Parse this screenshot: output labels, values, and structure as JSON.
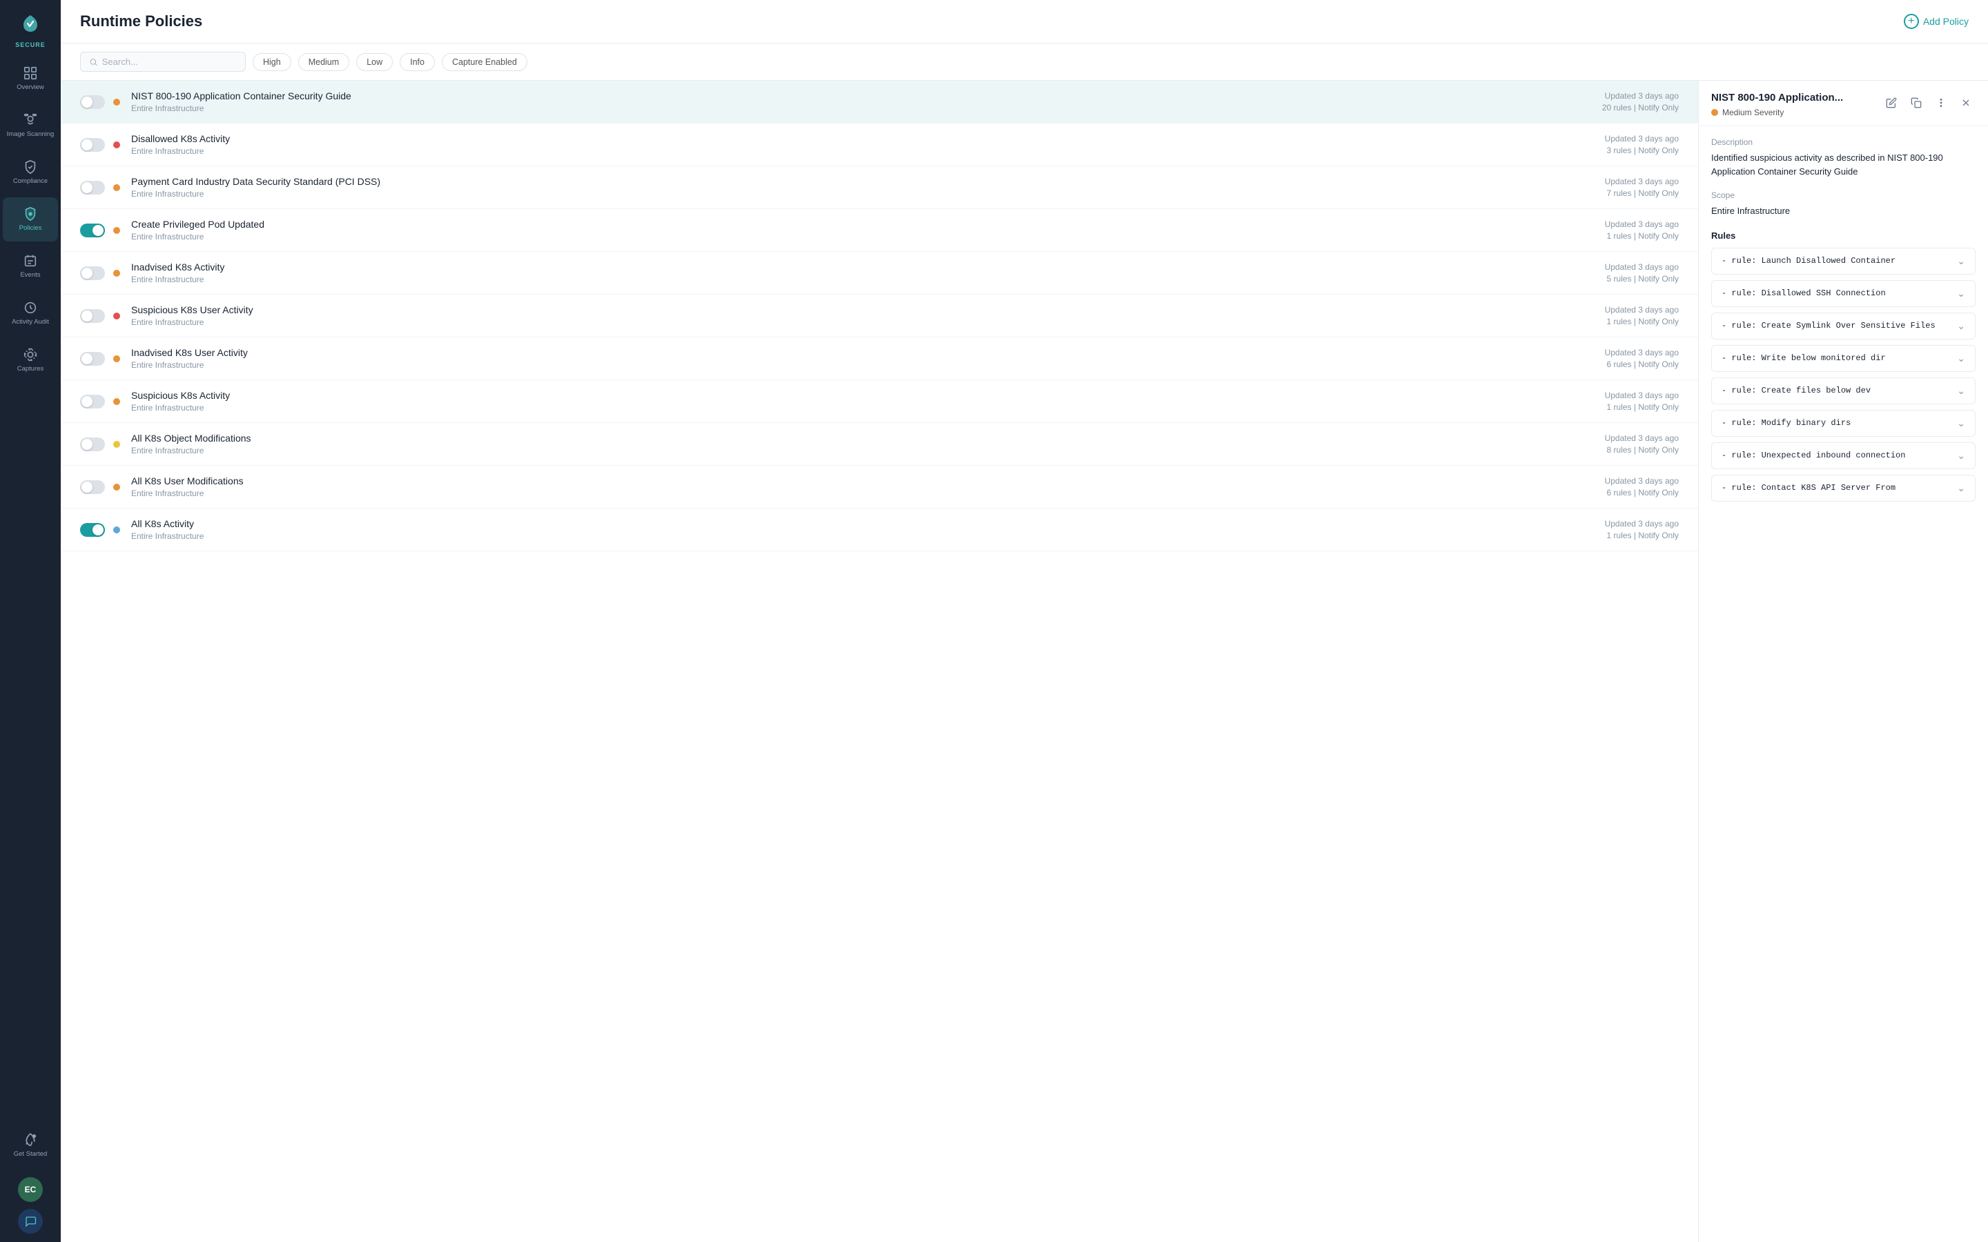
{
  "app": {
    "secure_label": "SECURE"
  },
  "sidebar": {
    "items": [
      {
        "id": "overview",
        "label": "Overview",
        "icon": "overview"
      },
      {
        "id": "image-scanning",
        "label": "Image Scanning",
        "icon": "scanning"
      },
      {
        "id": "compliance",
        "label": "Compliance",
        "icon": "compliance"
      },
      {
        "id": "policies",
        "label": "Policies",
        "icon": "policies",
        "active": true
      },
      {
        "id": "events",
        "label": "Events",
        "icon": "events"
      },
      {
        "id": "activity-audit",
        "label": "Activity Audit",
        "icon": "audit"
      },
      {
        "id": "captures",
        "label": "Captures",
        "icon": "captures"
      },
      {
        "id": "get-started",
        "label": "Get Started",
        "icon": "rocket"
      }
    ],
    "avatar_initials": "EC"
  },
  "header": {
    "title": "Runtime Policies",
    "add_policy_label": "Add Policy"
  },
  "filter_bar": {
    "search_placeholder": "Search...",
    "chips": [
      {
        "id": "high",
        "label": "High"
      },
      {
        "id": "medium",
        "label": "Medium"
      },
      {
        "id": "low",
        "label": "Low"
      },
      {
        "id": "info",
        "label": "Info"
      },
      {
        "id": "capture-enabled",
        "label": "Capture Enabled"
      }
    ]
  },
  "policies": [
    {
      "id": 1,
      "name": "NIST 800-190 Application Container Security Guide",
      "scope": "Entire Infrastructure",
      "updated": "Updated 3 days ago",
      "rules": "20 rules | Notify Only",
      "enabled": false,
      "severity": "orange",
      "selected": true
    },
    {
      "id": 2,
      "name": "Disallowed K8s Activity",
      "scope": "Entire Infrastructure",
      "updated": "Updated 3 days ago",
      "rules": "3 rules | Notify Only",
      "enabled": false,
      "severity": "red"
    },
    {
      "id": 3,
      "name": "Payment Card Industry Data Security Standard (PCI DSS)",
      "scope": "Entire Infrastructure",
      "updated": "Updated 3 days ago",
      "rules": "7 rules | Notify Only",
      "enabled": false,
      "severity": "orange"
    },
    {
      "id": 4,
      "name": "Create Privileged Pod Updated",
      "scope": "Entire Infrastructure",
      "updated": "Updated 3 days ago",
      "rules": "1 rules | Notify Only",
      "enabled": true,
      "severity": "orange"
    },
    {
      "id": 5,
      "name": "Inadvised K8s Activity",
      "scope": "Entire Infrastructure",
      "updated": "Updated 3 days ago",
      "rules": "5 rules | Notify Only",
      "enabled": false,
      "severity": "orange"
    },
    {
      "id": 6,
      "name": "Suspicious K8s User Activity",
      "scope": "Entire Infrastructure",
      "updated": "Updated 3 days ago",
      "rules": "1 rules | Notify Only",
      "enabled": false,
      "severity": "red"
    },
    {
      "id": 7,
      "name": "Inadvised K8s User Activity",
      "scope": "Entire Infrastructure",
      "updated": "Updated 3 days ago",
      "rules": "6 rules | Notify Only",
      "enabled": false,
      "severity": "orange"
    },
    {
      "id": 8,
      "name": "Suspicious K8s Activity",
      "scope": "Entire Infrastructure",
      "updated": "Updated 3 days ago",
      "rules": "1 rules | Notify Only",
      "enabled": false,
      "severity": "orange"
    },
    {
      "id": 9,
      "name": "All K8s Object Modifications",
      "scope": "Entire Infrastructure",
      "updated": "Updated 3 days ago",
      "rules": "8 rules | Notify Only",
      "enabled": false,
      "severity": "yellow"
    },
    {
      "id": 10,
      "name": "All K8s User Modifications",
      "scope": "Entire Infrastructure",
      "updated": "Updated 3 days ago",
      "rules": "6 rules | Notify Only",
      "enabled": false,
      "severity": "orange"
    },
    {
      "id": 11,
      "name": "All K8s Activity",
      "scope": "Entire Infrastructure",
      "updated": "Updated 3 days ago",
      "rules": "1 rules | Notify Only",
      "enabled": true,
      "severity": "blue"
    }
  ],
  "detail": {
    "title": "NIST 800-190 Application...",
    "severity_label": "Medium Severity",
    "severity_color": "#e8923a",
    "description_label": "Description",
    "description": "Identified suspicious activity as described in NIST 800-190 Application Container Security Guide",
    "scope_label": "Scope",
    "scope_value": "Entire Infrastructure",
    "rules_label": "Rules",
    "rules": [
      {
        "text": "- rule: Launch Disallowed Container"
      },
      {
        "text": "- rule: Disallowed SSH Connection"
      },
      {
        "text": "- rule: Create Symlink Over Sensitive Files"
      },
      {
        "text": "- rule: Write below monitored dir"
      },
      {
        "text": "- rule: Create files below dev"
      },
      {
        "text": "- rule: Modify binary dirs"
      },
      {
        "text": "- rule: Unexpected inbound connection"
      },
      {
        "text": "- rule: Contact K8S API Server From"
      }
    ]
  }
}
